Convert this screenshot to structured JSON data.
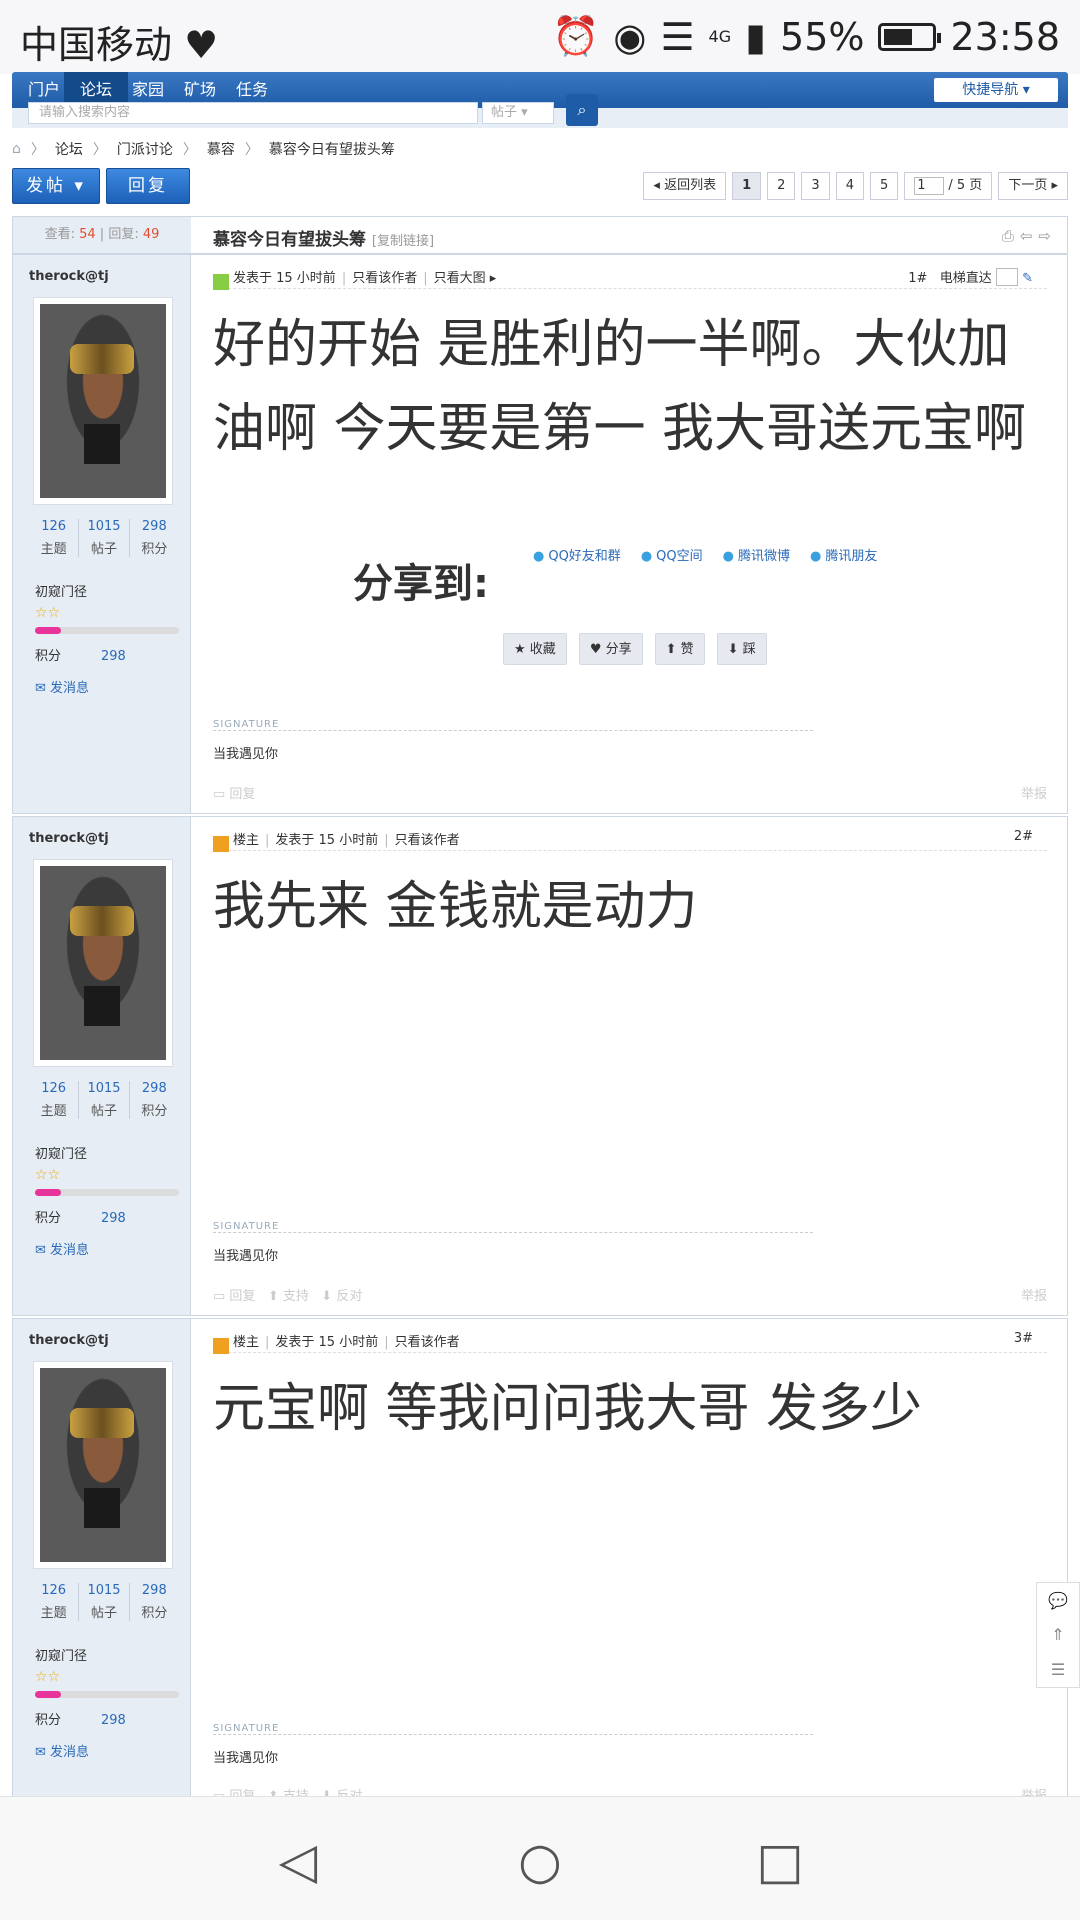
{
  "status_bar": {
    "carrier": "中国移动",
    "network": "4G",
    "battery": "55%",
    "time": "23:58"
  },
  "nav": {
    "tabs": [
      "门户",
      "论坛",
      "家园",
      "矿场",
      "任务"
    ],
    "active_tab": "论坛",
    "quick_nav": "快捷导航"
  },
  "search": {
    "placeholder": "请输入搜索内容",
    "type": "帖子"
  },
  "breadcrumb": [
    "论坛",
    "门派讨论",
    "慕容",
    "慕容今日有望拔头筹"
  ],
  "actions": {
    "post": "发帖",
    "reply": "回复"
  },
  "pager": {
    "back": "返回列表",
    "pages": [
      "1",
      "2",
      "3",
      "4",
      "5"
    ],
    "current_input": "1",
    "total": "/ 5 页",
    "next": "下一页"
  },
  "thread": {
    "views_label": "查看:",
    "views": "54",
    "replies_label": "回复:",
    "replies": "49",
    "title": "慕容今日有望拔头筹",
    "copy_link": "[复制链接]"
  },
  "user": {
    "name": "therock@tj",
    "topics": "126",
    "topics_label": "主题",
    "posts": "1015",
    "posts_label": "帖子",
    "points": "298",
    "points_label": "积分",
    "rank": "初窥门径",
    "stars": "☆☆",
    "rank_progress": 0.18,
    "points_row_label": "积分",
    "points_row_value": "298",
    "send_msg": "发消息"
  },
  "posts": [
    {
      "meta_prefix": "",
      "time": "发表于 15 小时前",
      "only_author": "只看该作者",
      "big_image": "只看大图",
      "floor": "1#",
      "elevator": "电梯直达",
      "text": "好的开始 是胜利的一半啊。大伙加油啊 今天要是第一 我大哥送元宝啊",
      "share_label": "分享到:",
      "share_items": [
        "QQ好友和群",
        "QQ空间",
        "腾讯微博",
        "腾讯朋友"
      ],
      "votes": [
        "收藏",
        "分享",
        "赞",
        "踩"
      ],
      "signature_tag": "SIGNATURE",
      "signature": "当我遇见你",
      "reply": "回复",
      "report": "举报"
    },
    {
      "owner": "楼主",
      "time": "发表于 15 小时前",
      "only_author": "只看该作者",
      "floor": "2#",
      "text": "我先来   金钱就是动力",
      "signature_tag": "SIGNATURE",
      "signature": "当我遇见你",
      "reply": "回复",
      "support": "支持",
      "oppose": "反对",
      "report": "举报"
    },
    {
      "owner": "楼主",
      "time": "发表于 15 小时前",
      "only_author": "只看该作者",
      "floor": "3#",
      "text": "元宝啊 等我问问我大哥 发多少",
      "signature_tag": "SIGNATURE",
      "signature": "当我遇见你",
      "reply": "回复",
      "support": "支持",
      "oppose": "反对",
      "report": "举报"
    }
  ]
}
